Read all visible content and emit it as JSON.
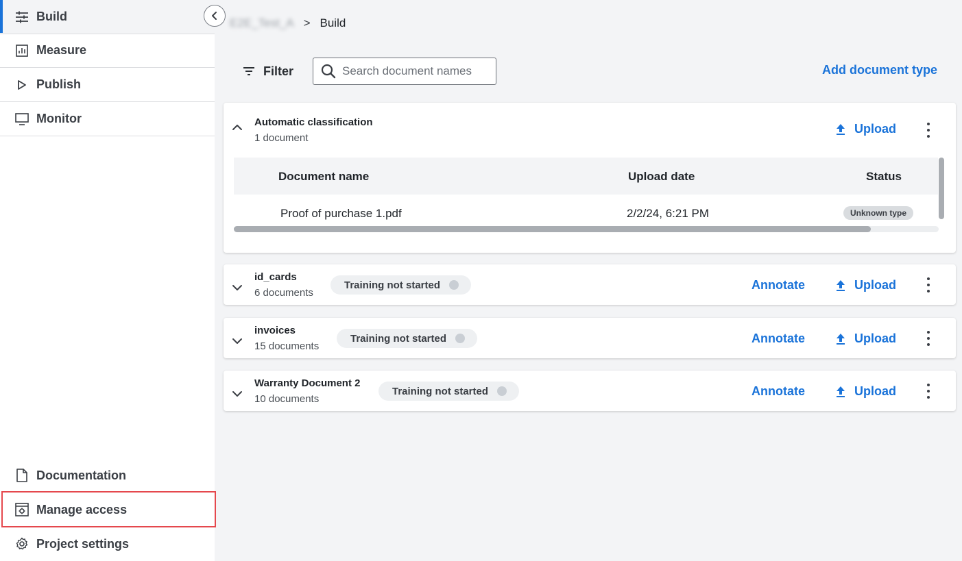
{
  "sidebar": {
    "nav": [
      {
        "label": "Build",
        "icon": "sliders-icon"
      },
      {
        "label": "Measure",
        "icon": "chart-icon"
      },
      {
        "label": "Publish",
        "icon": "play-icon"
      },
      {
        "label": "Monitor",
        "icon": "monitor-icon"
      }
    ],
    "bottom": [
      {
        "label": "Documentation",
        "icon": "document-icon"
      },
      {
        "label": "Manage access",
        "icon": "manage-access-icon"
      },
      {
        "label": "Project settings",
        "icon": "gear-icon"
      }
    ]
  },
  "breadcrumb": {
    "project": "E2E_Test_A",
    "separator": ">",
    "current": "Build"
  },
  "toolbar": {
    "filter_label": "Filter",
    "search_placeholder": "Search document names",
    "add_document_type": "Add document type"
  },
  "table": {
    "headers": {
      "name": "Document name",
      "date": "Upload date",
      "status": "Status"
    },
    "rows": [
      {
        "name": "Proof of purchase 1.pdf",
        "date": "2/2/24, 6:21 PM",
        "status": "Unknown type"
      }
    ]
  },
  "cards": [
    {
      "title": "Automatic classification",
      "subtitle": "1 document",
      "expanded": true,
      "upload_label": "Upload"
    },
    {
      "title": "id_cards",
      "subtitle": "6 documents",
      "status": "Training not started",
      "annotate_label": "Annotate",
      "upload_label": "Upload"
    },
    {
      "title": "invoices",
      "subtitle": "15 documents",
      "status": "Training not started",
      "annotate_label": "Annotate",
      "upload_label": "Upload"
    },
    {
      "title": "Warranty Document 2",
      "subtitle": "10 documents",
      "status": "Training not started",
      "annotate_label": "Annotate",
      "upload_label": "Upload"
    }
  ],
  "colors": {
    "accent": "#1a73d9",
    "highlight": "#e5484d"
  }
}
